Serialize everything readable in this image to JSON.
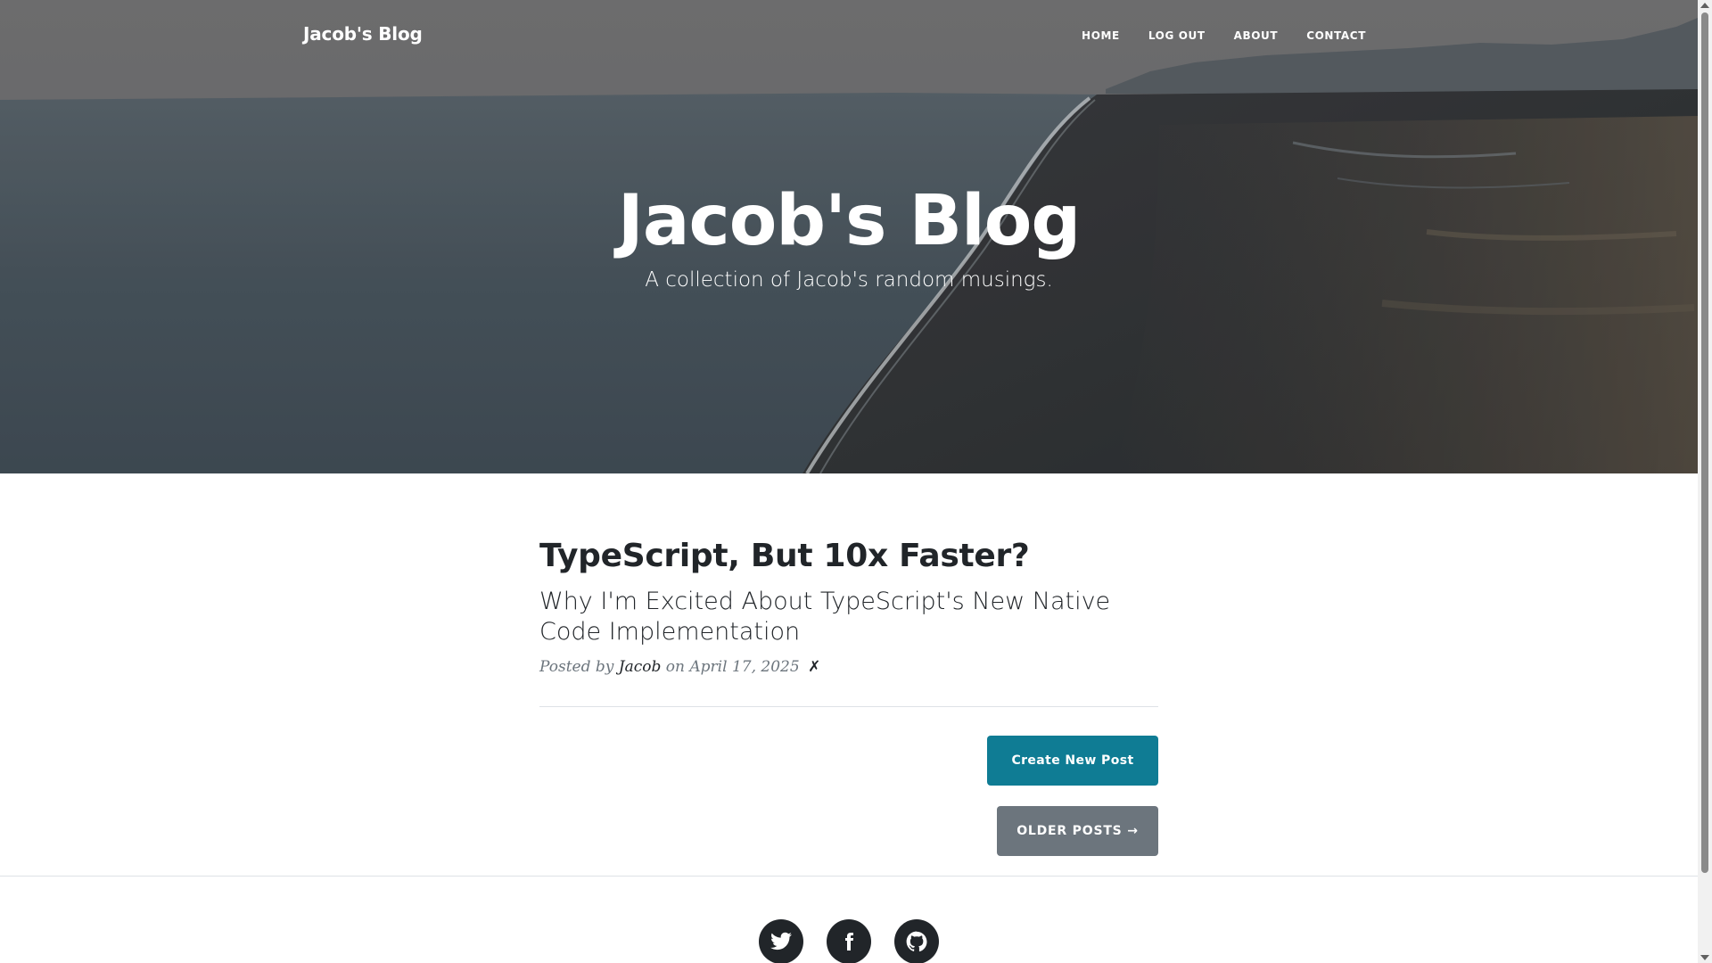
{
  "navbar": {
    "brand": "Jacob's Blog",
    "links": [
      {
        "label": "HOME"
      },
      {
        "label": "LOG OUT"
      },
      {
        "label": "ABOUT"
      },
      {
        "label": "CONTACT"
      }
    ]
  },
  "hero": {
    "title": "Jacob's Blog",
    "subtitle": "A collection of Jacob's random musings."
  },
  "posts": [
    {
      "title": "TypeScript, But 10x Faster?",
      "subtitle": "Why I'm Excited About TypeScript's New Native Code Implementation",
      "meta_prefix": "Posted by",
      "author": "Jacob",
      "meta_on": "on",
      "date": "April 17, 2025",
      "delete_symbol": "✗"
    }
  ],
  "actions": {
    "create_label": "Create New Post",
    "older_label": "OLDER POSTS →"
  },
  "footer": {
    "social": [
      {
        "icon": "twitter-icon"
      },
      {
        "icon": "facebook-icon"
      },
      {
        "icon": "github-icon"
      }
    ]
  },
  "colors": {
    "primary": "#0f7c94",
    "secondary": "#6c757d",
    "text": "#212529"
  }
}
